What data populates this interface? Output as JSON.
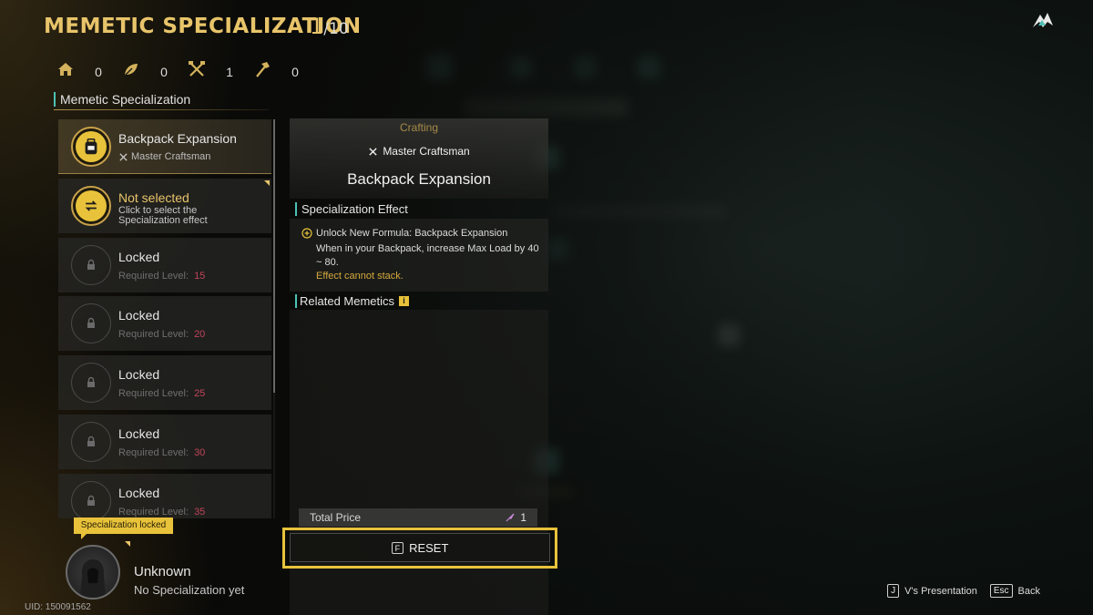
{
  "header": {
    "title": "MEMETIC SPECIALIZATION",
    "count_current": "1",
    "count_total": "/10"
  },
  "stats": [
    {
      "icon": "house-icon",
      "value": "0"
    },
    {
      "icon": "leaf-icon",
      "value": "0"
    },
    {
      "icon": "crossed-tools-icon",
      "value": "1"
    },
    {
      "icon": "hammer-icon",
      "value": "0"
    }
  ],
  "section_title": "Memetic Specialization",
  "specializations": [
    {
      "name": "Backpack Expansion",
      "sub": "Master Craftsman",
      "state": "active"
    },
    {
      "name": "Not selected",
      "desc": "Click to select the Specialization effect",
      "state": "select"
    },
    {
      "name": "Locked",
      "req_label": "Required Level:",
      "req_level": "15",
      "state": "locked"
    },
    {
      "name": "Locked",
      "req_label": "Required Level:",
      "req_level": "20",
      "state": "locked"
    },
    {
      "name": "Locked",
      "req_label": "Required Level:",
      "req_level": "25",
      "state": "locked"
    },
    {
      "name": "Locked",
      "req_label": "Required Level:",
      "req_level": "30",
      "state": "locked"
    },
    {
      "name": "Locked",
      "req_label": "Required Level:",
      "req_level": "35",
      "state": "locked"
    }
  ],
  "locked_tag": "Specialization locked",
  "profile": {
    "name": "Unknown",
    "subtitle": "No Specialization yet",
    "uid": "UID: 150091562"
  },
  "detail": {
    "category": "Crafting",
    "badge": "Master Craftsman",
    "title": "Backpack Expansion",
    "effect_heading": "Specialization Effect",
    "effect_line1": "Unlock New Formula: Backpack Expansion",
    "effect_line2": "When in your Backpack, increase Max Load by 40 ~ 80.",
    "effect_note": "Effect cannot stack.",
    "related_heading": "Related Memetics",
    "info_glyph": "i"
  },
  "price": {
    "label": "Total Price",
    "value": "1"
  },
  "reset": {
    "key": "F",
    "label": "RESET"
  },
  "hints": [
    {
      "key": "J",
      "label": "V's Presentation"
    },
    {
      "key": "Esc",
      "label": "Back"
    }
  ],
  "colors": {
    "accent_gold": "#e8c46a",
    "highlight_yellow": "#e8c23a",
    "teal_marker": "#4ec1b6",
    "level_red": "#c0445a"
  }
}
